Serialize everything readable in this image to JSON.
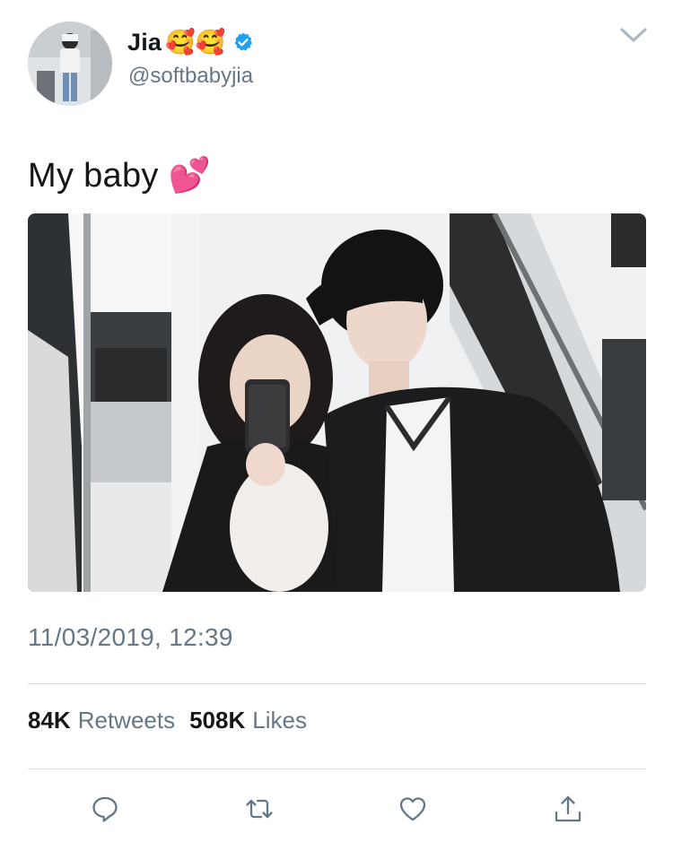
{
  "user": {
    "display_name": "Jia",
    "name_emojis": "🥰🥰",
    "handle": "@softbabyjia",
    "verified_icon": "verified-badge-icon",
    "avatar_icon": "avatar"
  },
  "tweet": {
    "text": "My baby 💕",
    "timestamp": "11/03/2019, 12:39",
    "media_icon": "couple-selfie-photo"
  },
  "stats": {
    "retweets_count": "84K",
    "retweets_label": "Retweets",
    "likes_count": "508K",
    "likes_label": "Likes"
  },
  "actions": {
    "reply_icon": "reply-icon",
    "retweet_icon": "retweet-icon",
    "like_icon": "heart-icon",
    "share_icon": "share-icon"
  },
  "menu_icon": "chevron-down-icon",
  "colors": {
    "text": "#14171a",
    "secondary": "#657786",
    "verified": "#1da1f2",
    "divider": "#d8dde2"
  }
}
